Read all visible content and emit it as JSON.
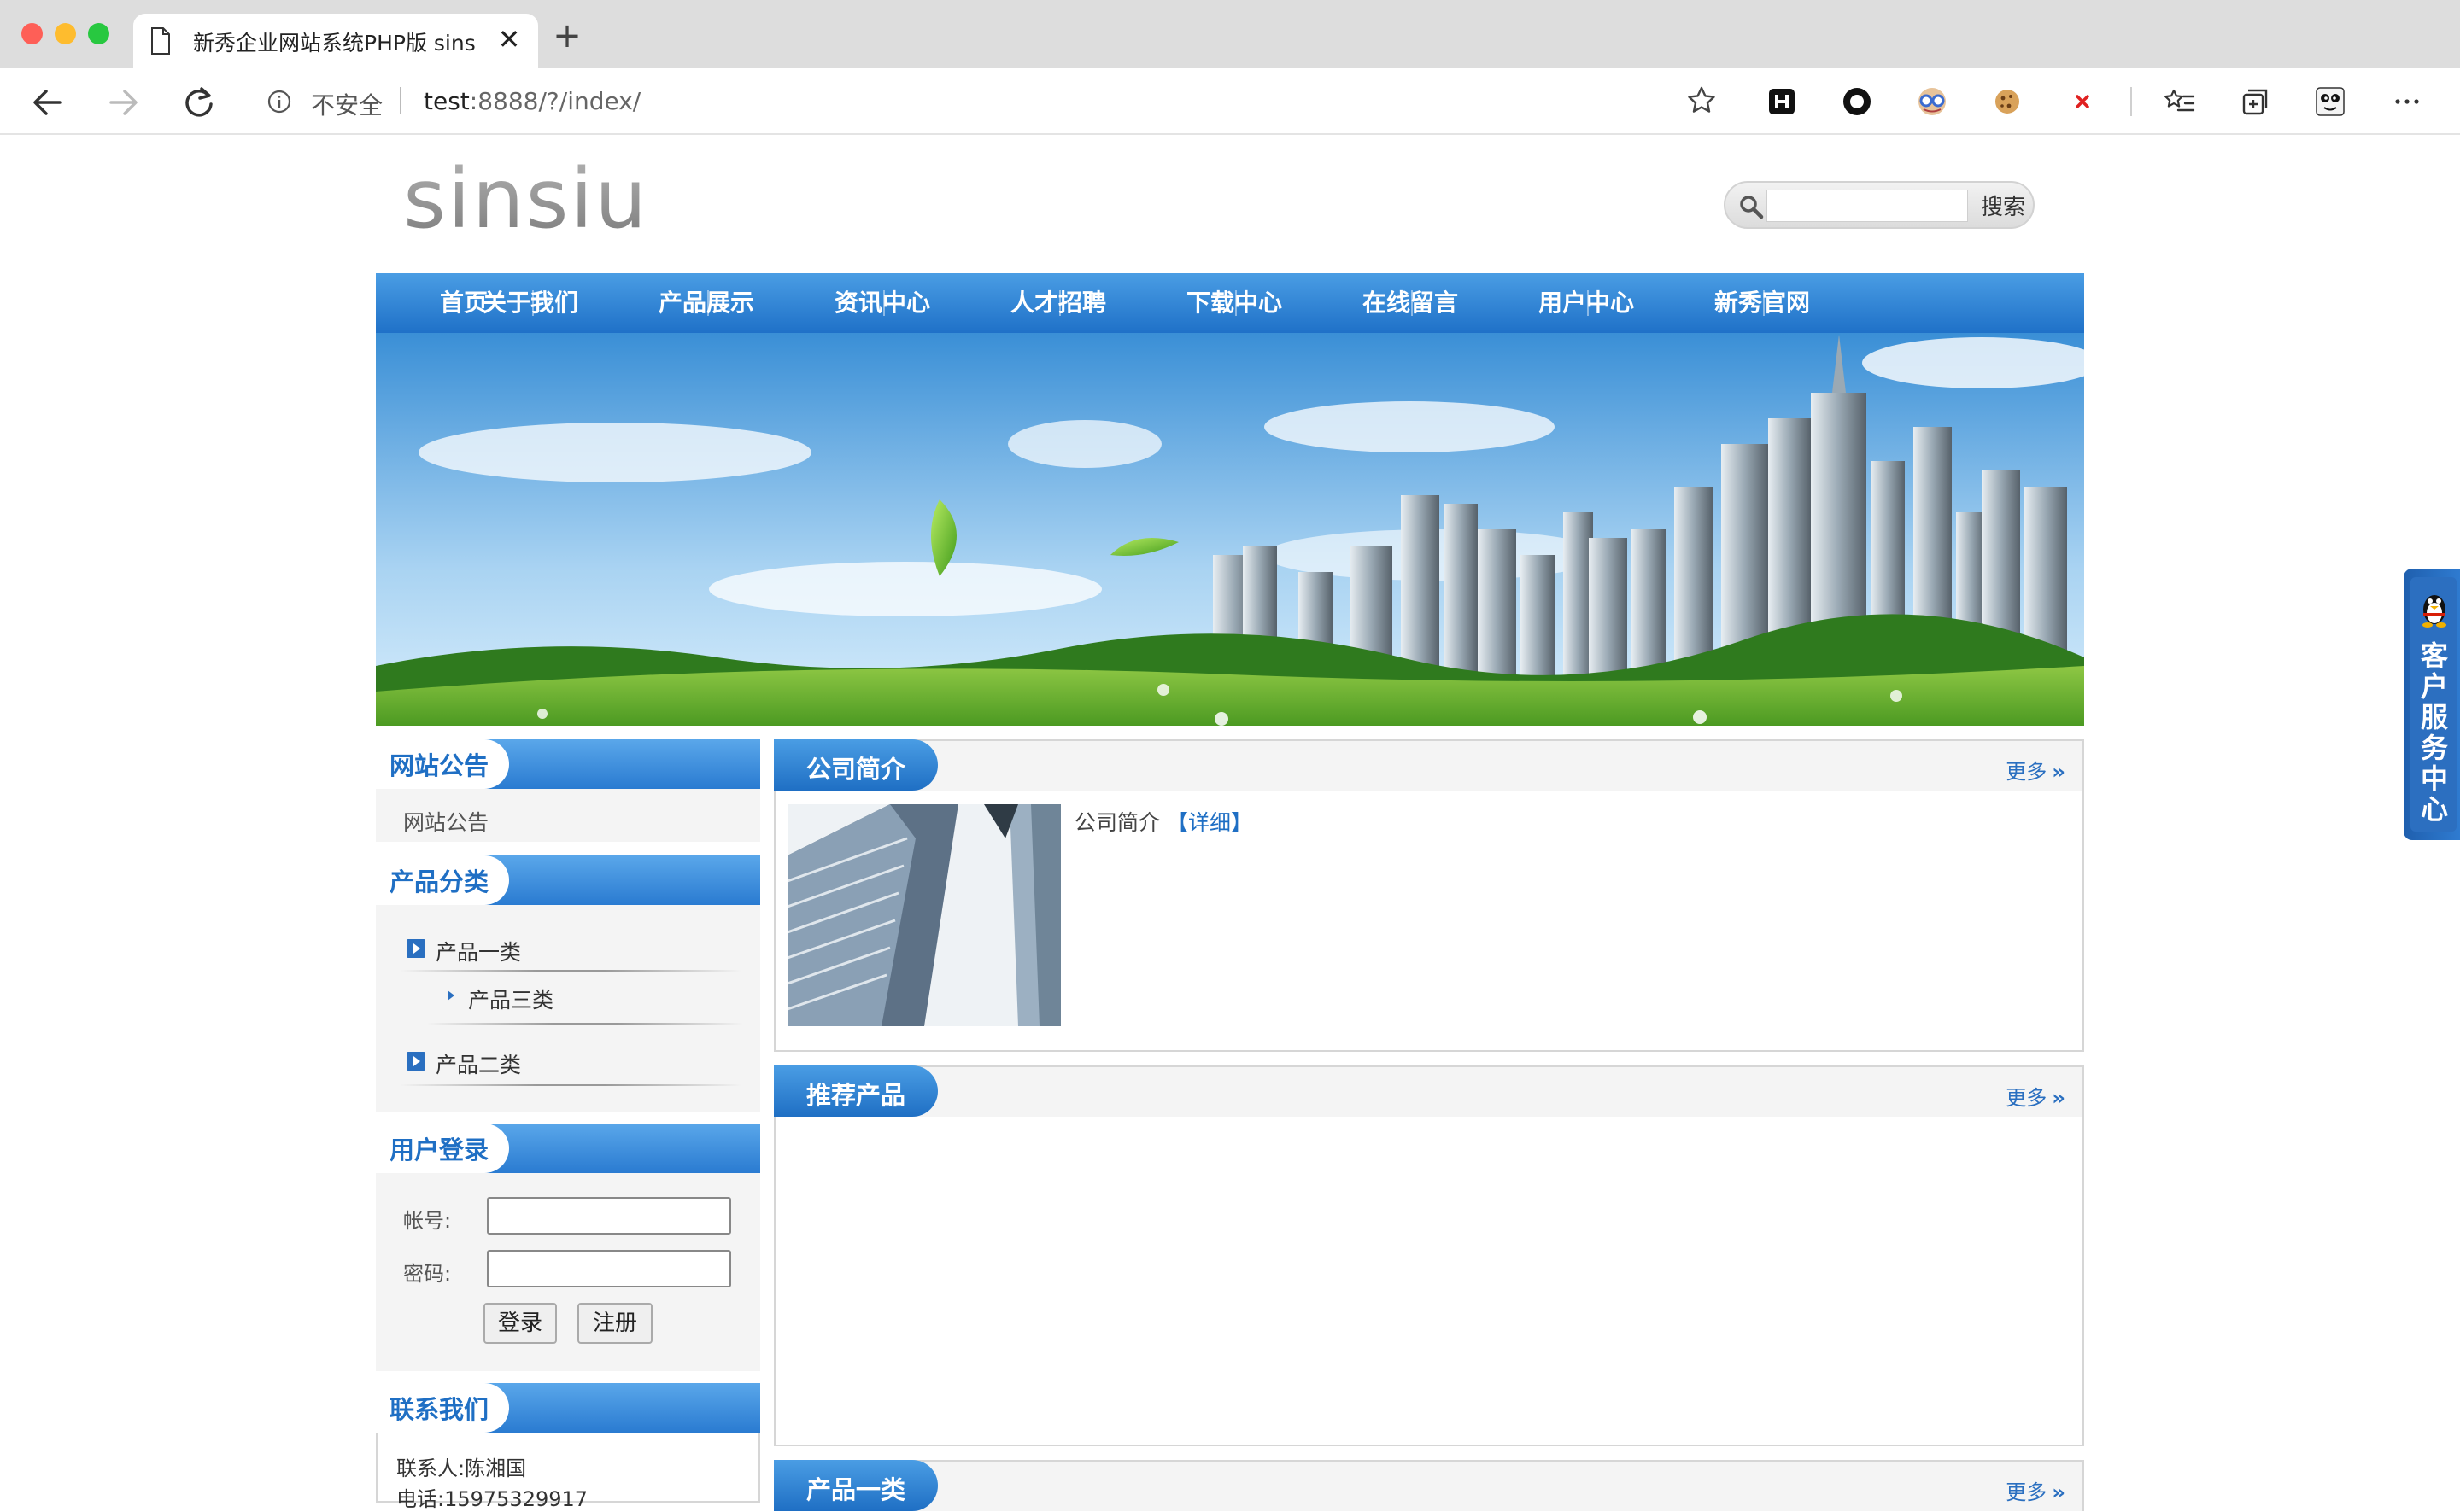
{
  "browser": {
    "tab_title": "新秀企业网站系统PHP版 sinsiu",
    "close_glyph": "✕",
    "newtab_glyph": "+",
    "security_label": "不安全",
    "url_host": "test",
    "url_rest": ":8888/?/index/"
  },
  "header": {
    "logo_text": "sinsiu",
    "search_placeholder": "",
    "search_button": "搜索"
  },
  "nav": {
    "items": [
      "首页",
      "关于我们",
      "产品展示",
      "资讯中心",
      "人才招聘",
      "下载中心",
      "在线留言",
      "用户中心",
      "新秀官网"
    ]
  },
  "sidebar": {
    "notice": {
      "title": "网站公告",
      "text": "网站公告"
    },
    "categories": {
      "title": "产品分类",
      "items": [
        {
          "label": "产品一类"
        },
        {
          "label": "产品三类"
        },
        {
          "label": "产品二类"
        }
      ]
    },
    "login": {
      "title": "用户登录",
      "account_label": "帐号:",
      "password_label": "密码:",
      "login_button": "登录",
      "register_button": "注册"
    },
    "contact": {
      "title": "联系我们",
      "person": "联系人:陈湘国",
      "phone": "电话:15975329917"
    }
  },
  "main": {
    "intro": {
      "title": "公司简介",
      "more": "更多",
      "text": "公司简介",
      "link": "【详细】"
    },
    "recommend": {
      "title": "推荐产品",
      "more": "更多"
    },
    "category1": {
      "title": "产品一类",
      "more": "更多"
    }
  },
  "service_tab": {
    "text": "客户服务中心"
  },
  "colors": {
    "nav_blue": "#2a7bd1",
    "link_blue": "#1f6fc4"
  }
}
